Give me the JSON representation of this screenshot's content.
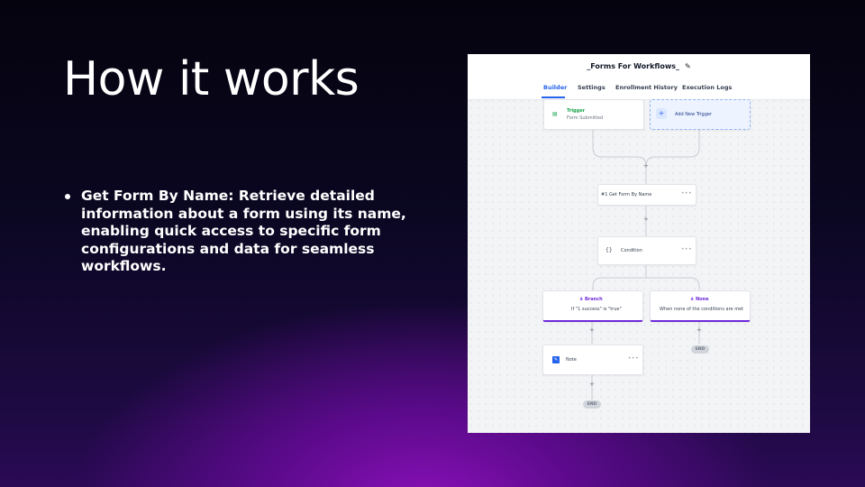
{
  "slide": {
    "title": "How it works",
    "bullet": "Get Form By Name: Retrieve detailed information about a form using its name, enabling quick access to specific form configurations and data for seamless workflows."
  },
  "workflow": {
    "title": "_Forms For Workflows_",
    "tabs": [
      "Builder",
      "Settings",
      "Enrollment History",
      "Execution Logs"
    ],
    "active_tab": "Builder",
    "trigger": {
      "label": "Trigger",
      "sub": "Form Submitted"
    },
    "add_trigger": "Add New Trigger",
    "action1": "#1 Get Form By Name",
    "condition": "Condition",
    "branch": {
      "label": "Branch",
      "sub": "If \"1 success\" is \"true\""
    },
    "none": {
      "label": "None",
      "sub": "When none of the conditions are met"
    },
    "note": "Note",
    "end_label": "END",
    "more": "•••",
    "plus": "+"
  },
  "colors": {
    "accent": "#2563eb",
    "trigger_green": "#16a34a",
    "branch_purple": "#6d28d9"
  }
}
